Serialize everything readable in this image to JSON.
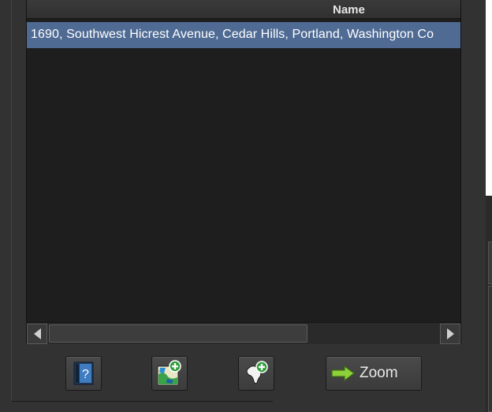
{
  "table": {
    "column_header": "Name",
    "rows": [
      "1690, Southwest Hicrest Avenue, Cedar Hills, Portland, Washington Co"
    ]
  },
  "toolbar": {
    "help_icon": "help-question-icon",
    "add_map_icon": "add-map-icon",
    "add_region_icon": "add-region-icon",
    "zoom_label": "Zoom",
    "zoom_icon": "green-arrow-right-icon"
  },
  "colors": {
    "selection": "#4f6b94",
    "table_bg": "#1e1e1e",
    "panel_bg": "#323232"
  }
}
